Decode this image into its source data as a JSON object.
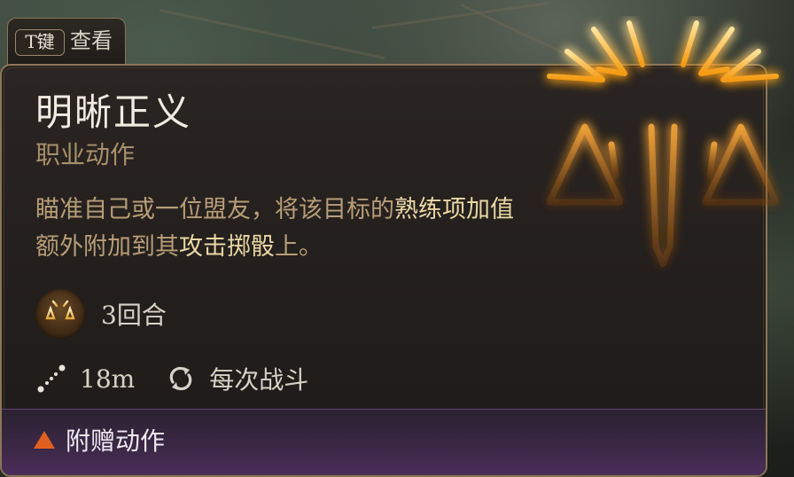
{
  "keybind": {
    "key": "T键",
    "action": "查看"
  },
  "spell": {
    "name": "明晰正义",
    "type": "职业动作",
    "description_parts": [
      {
        "text": "瞄准自己或一位盟友，将该目标的",
        "highlight": false
      },
      {
        "text": "熟练项加值",
        "highlight": true
      },
      {
        "text": "额外附加到其",
        "highlight": false
      },
      {
        "text": "攻击掷骰",
        "highlight": true
      },
      {
        "text": "上。",
        "highlight": false
      }
    ],
    "duration": "3回合",
    "range": "18m",
    "recharge": "每次战斗",
    "action_cost": "附赠动作"
  },
  "icons": {
    "emblem": "radiant-scales-emblem-icon",
    "duration": "scales-medallion-icon",
    "range": "range-ruler-icon",
    "recharge": "recharge-cycle-icon",
    "action_cost": "orange-triangle-icon"
  },
  "colors": {
    "title": "#f1ece2",
    "subtitle": "#a8906b",
    "description": "#b89d77",
    "highlight": "#ead7a4",
    "border": "#8c7657",
    "glow": "#f7a21d",
    "bonus_action": "#e0601f",
    "footer": "#4a2f59"
  }
}
